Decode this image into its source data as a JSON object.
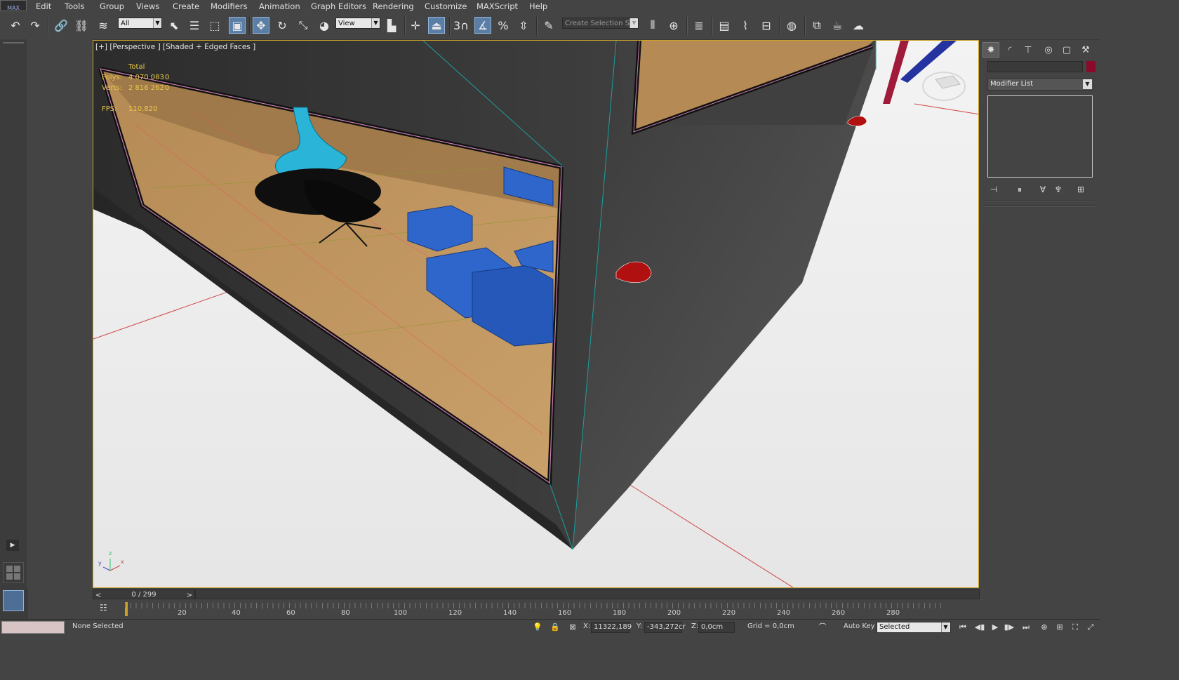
{
  "app": {
    "logo": "MAX"
  },
  "menu": [
    "Edit",
    "Tools",
    "Group",
    "Views",
    "Create",
    "Modifiers",
    "Animation",
    "Graph Editors",
    "Rendering",
    "Customize",
    "MAXScript",
    "Help"
  ],
  "toolbar": {
    "selection_filter": "All",
    "ref_coord": "View",
    "named_selection_placeholder": "Create Selection Se",
    "snap_label": "3"
  },
  "viewport": {
    "label": "[+] [Perspective ] [Shaded + Edged Faces ]",
    "stats_total": "Total",
    "polys_label": "Polys:",
    "polys_value": "4 070 083",
    "polys_sel": "0",
    "verts_label": "Verts:",
    "verts_value": "2 816 262",
    "verts_sel": "0",
    "fps_label": "FPS:",
    "fps_value": "110,820",
    "axis_x": "x",
    "axis_y": "y",
    "axis_z": "z"
  },
  "command_panel": {
    "modifier_list": "Modifier List",
    "object_color": "#8b0a2c"
  },
  "timeslider": {
    "frame": "0 / 299",
    "prev": "<",
    "next": ">"
  },
  "trackbar": {
    "ticks": [
      "20",
      "40",
      "60",
      "80",
      "100",
      "120",
      "140",
      "160",
      "180",
      "200",
      "220",
      "240",
      "260",
      "280"
    ]
  },
  "status": {
    "selection": "None Selected",
    "x_label": "X:",
    "x_value": "11322,189",
    "y_label": "Y:",
    "y_value": "-343,272cr",
    "z_label": "Z:",
    "z_value": "0,0cm",
    "grid": "Grid = 0,0cm",
    "autokey": "Auto Key",
    "key_mode": "Selected"
  }
}
